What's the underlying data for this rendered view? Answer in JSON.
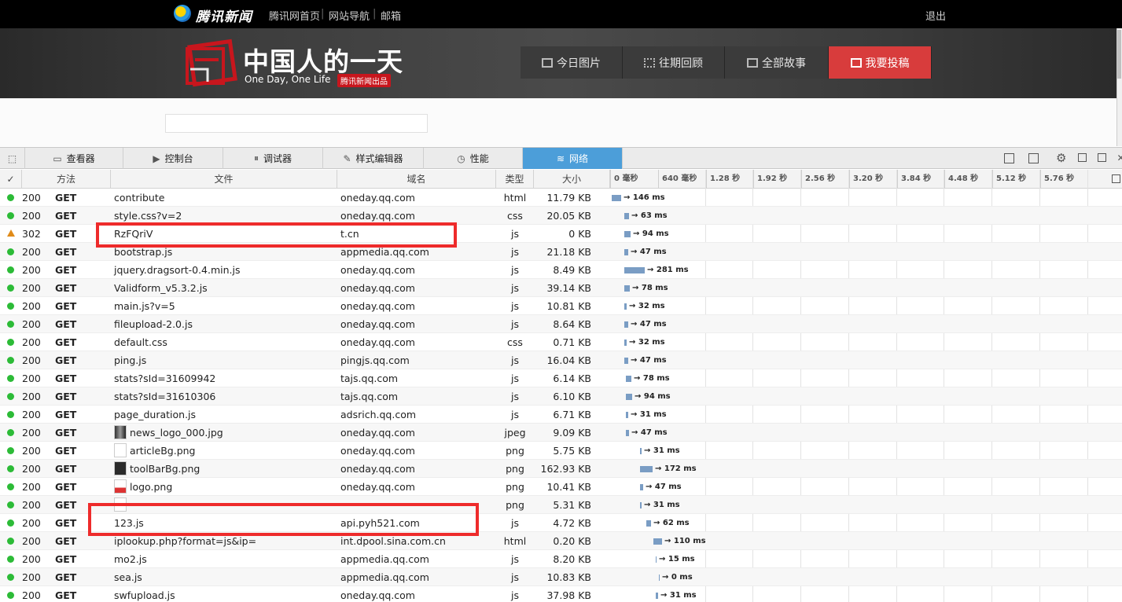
{
  "topbar": {
    "brand": "腾讯新闻",
    "links": [
      "腾讯网首页",
      "网站导航",
      "邮箱"
    ],
    "logout": "退出"
  },
  "banner": {
    "title": "中国人的一天",
    "subtitle": "One Day, One Life",
    "badge": "腾讯新闻出品",
    "nav": [
      "今日图片",
      "往期回顾",
      "全部故事",
      "我要投稿"
    ],
    "active_nav": "我要投稿"
  },
  "devtools": {
    "tabs": [
      "查看器",
      "控制台",
      "调试器",
      "样式编辑器",
      "性能",
      "网络"
    ],
    "selected_tab": "网络",
    "columns": {
      "check": "✓",
      "method": "方法",
      "file": "文件",
      "domain": "域名",
      "type": "类型",
      "size": "大小"
    },
    "timeline_ticks": [
      "0 毫秒",
      "640 毫秒",
      "1.28 秒",
      "1.92 秒",
      "2.56 秒",
      "3.20 秒",
      "3.84 秒",
      "4.48 秒",
      "5.12 秒",
      "5.76 秒"
    ],
    "requests": [
      {
        "status": "200",
        "method": "GET",
        "file": "contribute",
        "domain": "oneday.qq.com",
        "type": "html",
        "size": "11.79 KB",
        "time": "→ 146 ms"
      },
      {
        "status": "200",
        "method": "GET",
        "file": "style.css?v=2",
        "domain": "oneday.qq.com",
        "type": "css",
        "size": "20.05 KB",
        "time": "→ 63 ms"
      },
      {
        "status": "302",
        "method": "GET",
        "file": "RzFQriV",
        "domain": "t.cn",
        "type": "js",
        "size": "0 KB",
        "time": "→ 94 ms"
      },
      {
        "status": "200",
        "method": "GET",
        "file": "bootstrap.js",
        "domain": "appmedia.qq.com",
        "type": "js",
        "size": "21.18 KB",
        "time": "→ 47 ms"
      },
      {
        "status": "200",
        "method": "GET",
        "file": "jquery.dragsort-0.4.min.js",
        "domain": "oneday.qq.com",
        "type": "js",
        "size": "8.49 KB",
        "time": "→ 281 ms"
      },
      {
        "status": "200",
        "method": "GET",
        "file": "Validform_v5.3.2.js",
        "domain": "oneday.qq.com",
        "type": "js",
        "size": "39.14 KB",
        "time": "→ 78 ms"
      },
      {
        "status": "200",
        "method": "GET",
        "file": "main.js?v=5",
        "domain": "oneday.qq.com",
        "type": "js",
        "size": "10.81 KB",
        "time": "→ 32 ms"
      },
      {
        "status": "200",
        "method": "GET",
        "file": "fileupload-2.0.js",
        "domain": "oneday.qq.com",
        "type": "js",
        "size": "8.64 KB",
        "time": "→ 47 ms"
      },
      {
        "status": "200",
        "method": "GET",
        "file": "default.css",
        "domain": "oneday.qq.com",
        "type": "css",
        "size": "0.71 KB",
        "time": "→ 32 ms"
      },
      {
        "status": "200",
        "method": "GET",
        "file": "ping.js",
        "domain": "pingjs.qq.com",
        "type": "js",
        "size": "16.04 KB",
        "time": "→ 47 ms"
      },
      {
        "status": "200",
        "method": "GET",
        "file": "stats?sId=31609942",
        "domain": "tajs.qq.com",
        "type": "js",
        "size": "6.14 KB",
        "time": "→ 78 ms"
      },
      {
        "status": "200",
        "method": "GET",
        "file": "stats?sId=31610306",
        "domain": "tajs.qq.com",
        "type": "js",
        "size": "6.10 KB",
        "time": "→ 94 ms"
      },
      {
        "status": "200",
        "method": "GET",
        "file": "page_duration.js",
        "domain": "adsrich.qq.com",
        "type": "js",
        "size": "6.71 KB",
        "time": "→ 31 ms"
      },
      {
        "status": "200",
        "method": "GET",
        "file": "news_logo_000.jpg",
        "domain": "oneday.qq.com",
        "type": "jpeg",
        "size": "9.09 KB",
        "time": "→ 47 ms"
      },
      {
        "status": "200",
        "method": "GET",
        "file": "articleBg.png",
        "domain": "oneday.qq.com",
        "type": "png",
        "size": "5.75 KB",
        "time": "→ 31 ms"
      },
      {
        "status": "200",
        "method": "GET",
        "file": "toolBarBg.png",
        "domain": "oneday.qq.com",
        "type": "png",
        "size": "162.93 KB",
        "time": "→ 172 ms"
      },
      {
        "status": "200",
        "method": "GET",
        "file": "logo.png",
        "domain": "oneday.qq.com",
        "type": "png",
        "size": "10.41 KB",
        "time": "→ 47 ms"
      },
      {
        "status": "200",
        "method": "GET",
        "file": "",
        "domain": "",
        "type": "png",
        "size": "5.31 KB",
        "time": "→ 31 ms"
      },
      {
        "status": "200",
        "method": "GET",
        "file": "123.js",
        "domain": "api.pyh521.com",
        "type": "js",
        "size": "4.72 KB",
        "time": "→ 62 ms"
      },
      {
        "status": "200",
        "method": "GET",
        "file": "iplookup.php?format=js&ip=",
        "domain": "int.dpool.sina.com.cn",
        "type": "html",
        "size": "0.20 KB",
        "time": "→ 110 ms"
      },
      {
        "status": "200",
        "method": "GET",
        "file": "mo2.js",
        "domain": "appmedia.qq.com",
        "type": "js",
        "size": "8.20 KB",
        "time": "→ 15 ms"
      },
      {
        "status": "200",
        "method": "GET",
        "file": "sea.js",
        "domain": "appmedia.qq.com",
        "type": "js",
        "size": "10.83 KB",
        "time": "→ 0 ms"
      },
      {
        "status": "200",
        "method": "GET",
        "file": "swfupload.js",
        "domain": "oneday.qq.com",
        "type": "js",
        "size": "37.98 KB",
        "time": "→ 31 ms"
      }
    ]
  },
  "colors": {
    "ok": "#2cbb37",
    "redirect": "#e08b19",
    "highlight": "#ee2b2b",
    "selected_tab": "#4c9ed9",
    "active_nav": "#d83c3c"
  }
}
